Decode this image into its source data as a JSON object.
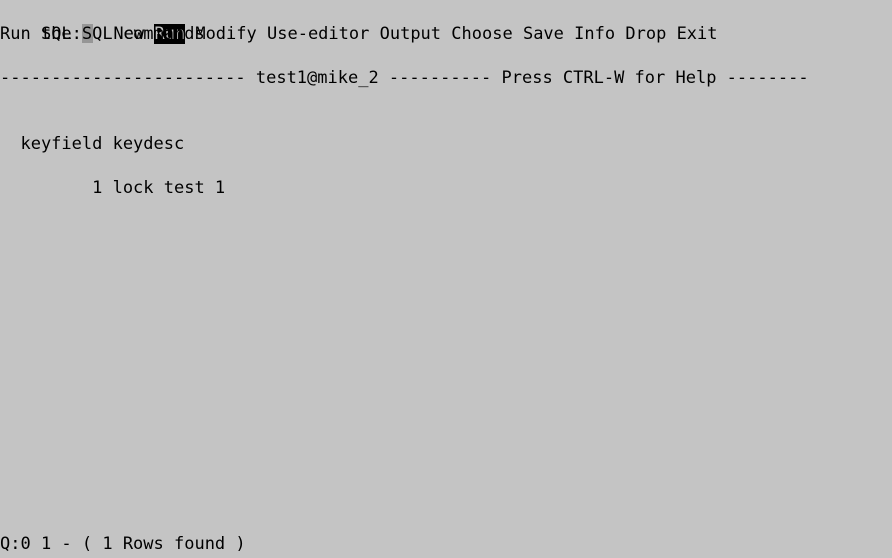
{
  "terminal": {
    "columns": 80,
    "rows": 25,
    "background_color": "#c4c4c4",
    "foreground_color": "#000000",
    "cursor_color": "#969696",
    "highlight_background": "#000000",
    "highlight_foreground": "#c4c4c4"
  },
  "prompt": {
    "label": "SQL:",
    "cursor": "block"
  },
  "menu": {
    "selected": "Run",
    "items": [
      {
        "label": "New",
        "selected": false
      },
      {
        "label": "Run",
        "selected": true
      },
      {
        "label": "Modify",
        "selected": false
      },
      {
        "label": "Use-editor",
        "selected": false
      },
      {
        "label": "Output",
        "selected": false
      },
      {
        "label": "Choose",
        "selected": false
      },
      {
        "label": "Save",
        "selected": false
      },
      {
        "label": "Info",
        "selected": false
      },
      {
        "label": "Drop",
        "selected": false
      },
      {
        "label": "Exit",
        "selected": false
      }
    ]
  },
  "hint": {
    "text": "Run the SQL commands"
  },
  "header": {
    "left_rule": "------------------------",
    "database": "test1@mike_2",
    "mid_rule": "----------",
    "help_text": "Press CTRL-W for Help",
    "right_rule": "--------",
    "full_line": "------------------------ test1@mike_2 ---------- Press CTRL-W for Help --------"
  },
  "results": {
    "column_headers": [
      "keyfield",
      "keydesc"
    ],
    "header_line": "  keyfield keydesc",
    "rows": [
      {
        "line": "         1 lock test 1",
        "keyfield": "1",
        "keydesc": "lock test 1"
      }
    ]
  },
  "status": {
    "text": "Q:0 1 - ( 1 Rows found )",
    "query_id": "Q:0",
    "line_number": "1",
    "separator": "-",
    "rows_found_text": "( 1 Rows found )",
    "rows_found_count": "1"
  }
}
